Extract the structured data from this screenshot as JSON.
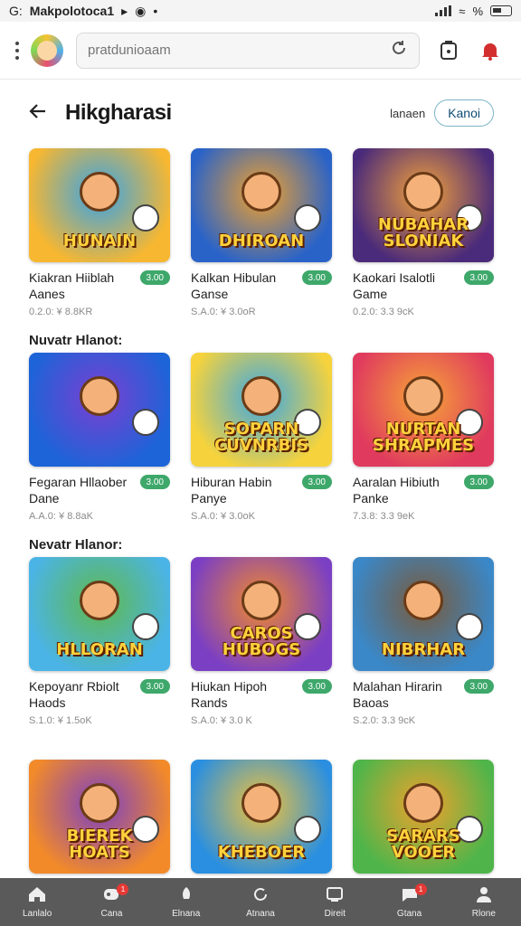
{
  "status_bar": {
    "carrier": "G:",
    "app_name": "Makpolotoca1",
    "battery": "%"
  },
  "topbar": {
    "search_placeholder": "pratdunioaam",
    "notification_count": ""
  },
  "header": {
    "title": "Hikgharasi",
    "aux_label": "lanaen",
    "pill_label": "Kanoi"
  },
  "sections": [
    {
      "title": "Nuvatr Hlanot:"
    },
    {
      "title": "Nevatr Hlanor:"
    }
  ],
  "games": [
    {
      "name": "Kiakran Hiiblah Aanes",
      "score": "3.00",
      "sub": "0.2.0: ¥ 8.8KR",
      "thumb_label": "HUNAIN",
      "bg1": "#f7b731",
      "bg2": "#36a3e8"
    },
    {
      "name": "Kalkan Hibulan Ganse",
      "score": "3.00",
      "sub": "S.A.0: ¥ 3.0oR",
      "thumb_label": "DHIROAN",
      "bg1": "#2a63c8",
      "bg2": "#f2a12b"
    },
    {
      "name": "Kaokari Isalotli Game",
      "score": "3.00",
      "sub": "0.2.0: 3.3 9cK",
      "thumb_label": "NUBAHAR SLONIAK",
      "bg1": "#4a2a7a",
      "bg2": "#f4a23a"
    },
    {
      "name": "Fegaran Hllaober Dane",
      "score": "3.00",
      "sub": "A.A.0: ¥ 8.8aK",
      "thumb_label": "",
      "bg1": "#1c64d8",
      "bg2": "#7b3fd1"
    },
    {
      "name": "Hiburan Habin Panye",
      "score": "3.00",
      "sub": "S.A.0: ¥ 3.0oK",
      "thumb_label": "SOPARN CUVNRBIS",
      "bg1": "#f6d33c",
      "bg2": "#3aa7e6"
    },
    {
      "name": "Aaralan Hibiuth Panke",
      "score": "3.00",
      "sub": "7.3.8: 3.3 9eK",
      "thumb_label": "NURTAN SHRAPMES",
      "bg1": "#e03a5e",
      "bg2": "#f6a637"
    },
    {
      "name": "Kepoyanr Rbiolt Haods",
      "score": "3.00",
      "sub": "S.1.0: ¥ 1.5oK",
      "thumb_label": "HLLORAN",
      "bg1": "#4bb4e6",
      "bg2": "#5fb94a"
    },
    {
      "name": "Hiukan Hipoh Rands",
      "score": "3.00",
      "sub": "S.A.0: ¥ 3.0 K",
      "thumb_label": "CAROS HUBOGS",
      "bg1": "#7b3fc4",
      "bg2": "#f28a2a"
    },
    {
      "name": "Malahan Hirarin Baoas",
      "score": "3.00",
      "sub": "S.2.0: 3.3 9cK",
      "thumb_label": "NIBRHAR",
      "bg1": "#3a88c8",
      "bg2": "#7a5a3a"
    },
    {
      "name": "",
      "score": "",
      "sub": "",
      "thumb_label": "BIEREK HOATS",
      "bg1": "#f28a2a",
      "bg2": "#7b3fc4"
    },
    {
      "name": "",
      "score": "",
      "sub": "",
      "thumb_label": "KHEBOER",
      "bg1": "#2a8fe0",
      "bg2": "#f2c23a"
    },
    {
      "name": "",
      "score": "",
      "sub": "",
      "thumb_label": "SARARS VOOER",
      "bg1": "#4fb54a",
      "bg2": "#f2a12b"
    }
  ],
  "bottom_nav": [
    {
      "label": "Lanlalo",
      "icon": "home-icon",
      "badge": ""
    },
    {
      "label": "Cana",
      "icon": "controller-icon",
      "badge": "1"
    },
    {
      "label": "Elnana",
      "icon": "rocket-icon",
      "badge": ""
    },
    {
      "label": "Atnana",
      "icon": "refresh-icon",
      "badge": ""
    },
    {
      "label": "Direit",
      "icon": "screen-icon",
      "badge": ""
    },
    {
      "label": "Gtana",
      "icon": "chat-icon",
      "badge": "1"
    },
    {
      "label": "Rlone",
      "icon": "profile-icon",
      "badge": ""
    }
  ]
}
